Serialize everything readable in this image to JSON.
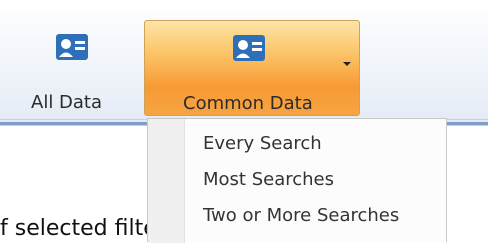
{
  "ribbon": {
    "buttons": [
      {
        "label": "All Data",
        "icon": "contact-card-icon"
      },
      {
        "label": "Common Data",
        "icon": "contact-card-icon",
        "has_dropdown": true
      }
    ]
  },
  "dropdown": {
    "items": [
      "Every Search",
      "Most Searches",
      "Two or More Searches"
    ]
  },
  "background_text": "f selected filters that an entity is found",
  "colors": {
    "icon_blue": "#2f6fb8",
    "active_button_orange": "#f79a35",
    "ribbon_border": "#7f9dc8"
  }
}
